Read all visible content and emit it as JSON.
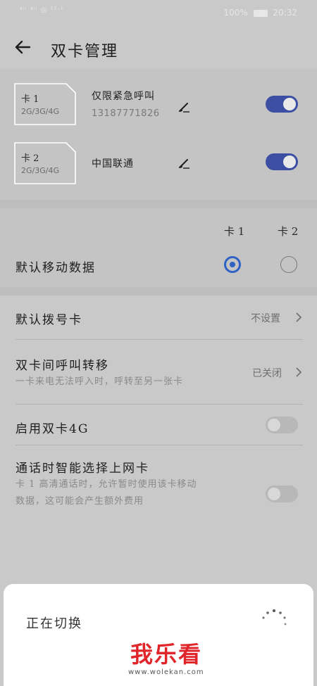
{
  "status_bar": {
    "left_text": "⁴ⁱᴵ ⁴ⁱᴵ ◎ ¹⁵·¹",
    "battery_pct": "100%",
    "time": "20:32"
  },
  "header": {
    "title": "双卡管理",
    "back_icon": "arrow-left-icon"
  },
  "sims": [
    {
      "slot": "卡 1",
      "network": "2G/3G/4G",
      "name": "仅限紧急呼叫",
      "number": "13187771826",
      "enabled": true
    },
    {
      "slot": "卡 2",
      "network": "2G/3G/4G",
      "name": "中国联通",
      "number": "",
      "enabled": true
    }
  ],
  "mobile_data": {
    "col1": "卡 1",
    "col2": "卡 2",
    "label": "默认移动数据",
    "selected": "卡 1"
  },
  "settings": {
    "default_dial": {
      "label": "默认拨号卡",
      "value": "不设置"
    },
    "call_forward": {
      "label": "双卡间呼叫转移",
      "desc": "一卡来电无法呼入时，呼转至另一张卡",
      "value": "已关闭"
    },
    "dual_4g": {
      "label": "启用双卡4G",
      "enabled": false
    },
    "smart_select": {
      "label": "通话时智能选择上网卡",
      "desc_line1": "卡 1 高清通话时，允许暂时使用该卡移动",
      "desc_line2": "数据，这可能会产生额外费用",
      "enabled": false
    }
  },
  "dialog": {
    "text": "正在切换"
  },
  "watermark": {
    "logo": "我乐看",
    "url": "www.wolekan.com"
  },
  "colors": {
    "toggle_on": "#3d4fa3",
    "radio_on": "#2f62c4",
    "watermark_red": "#e0262a"
  }
}
